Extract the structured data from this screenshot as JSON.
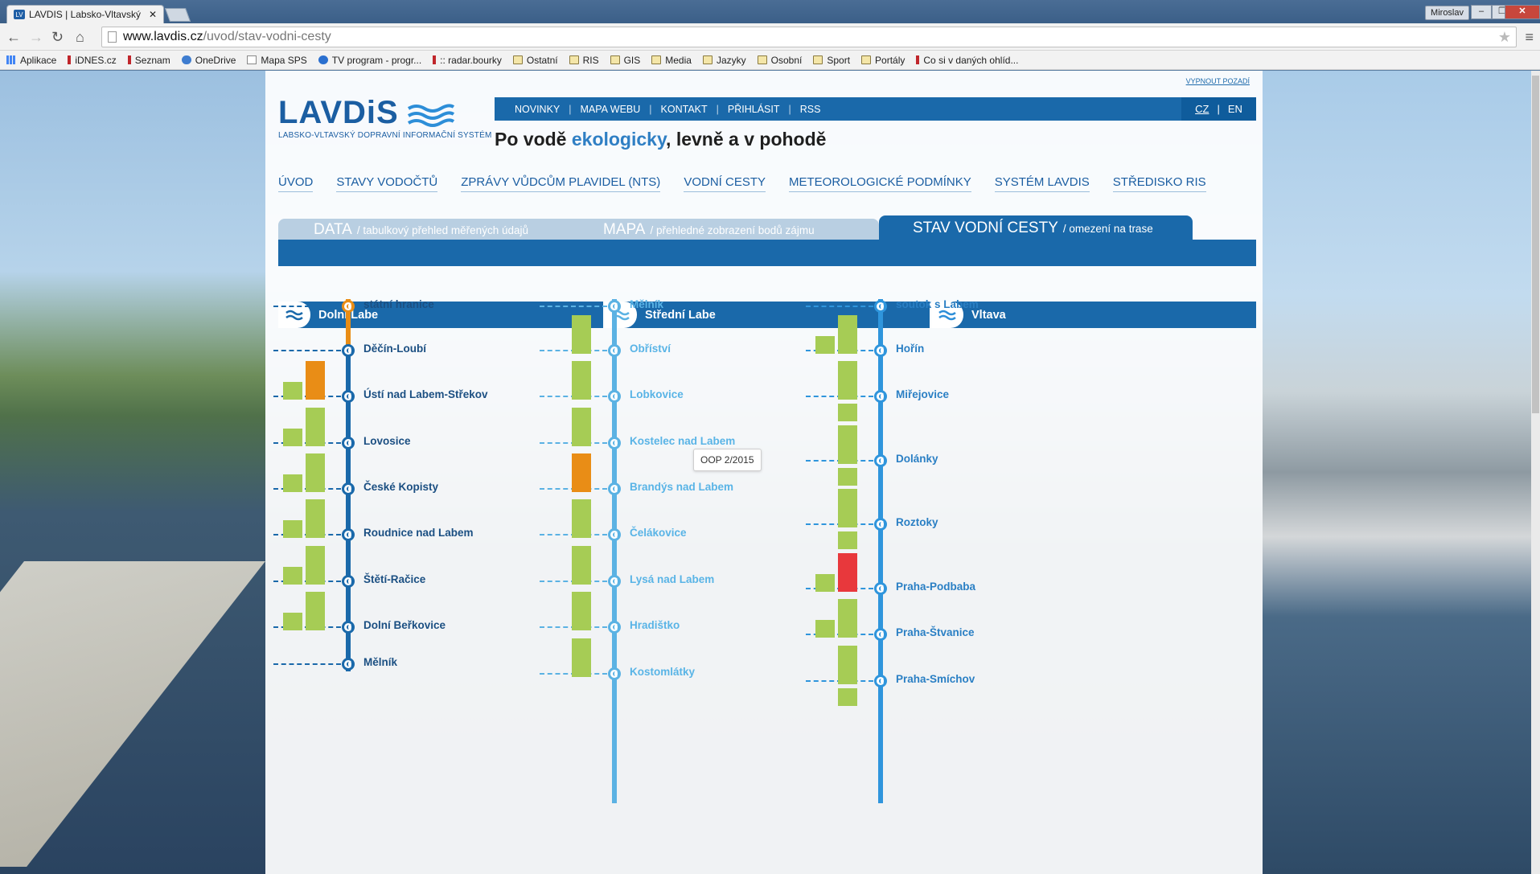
{
  "browser": {
    "tab_title": "LAVDIS | Labsko-Vltavský",
    "tab_close": "✕",
    "user": "Miroslav",
    "url_host": "www.lavdis.cz",
    "url_path": "/uvod/stav-vodni-cesty",
    "bookmarks": [
      "Aplikace",
      "iDNES.cz",
      "Seznam",
      "OneDrive",
      "Mapa SPS",
      "TV program - progr...",
      ":: radar.bourky",
      "Ostatní",
      "RIS",
      "GIS",
      "Media",
      "Jazyky",
      "Osobní",
      "Sport",
      "Portály",
      "Co si v daných ohlíd..."
    ]
  },
  "site": {
    "hide_bg": "VYPNOUT POZADÍ",
    "logo": "LAVDiS",
    "logo_sub": "LABSKO-VLTAVSKÝ DOPRAVNÍ INFORMAČNÍ SYSTÉM",
    "topnav": [
      "NOVINKY",
      "MAPA WEBU",
      "KONTAKT",
      "PŘIHLÁSIT",
      "RSS"
    ],
    "lang": [
      "CZ",
      "EN"
    ],
    "slogan_a": "Po vodě ",
    "slogan_b": "ekologicky",
    "slogan_c": ", levně a v pohodě",
    "mainnav": [
      "ÚVOD",
      "STAVY VODOČTŮ",
      "ZPRÁVY VŮDCŮM PLAVIDEL (NTS)",
      "VODNÍ CESTY",
      "METEOROLOGICKÉ PODMÍNKY",
      "SYSTÉM LAVDIS",
      "STŘEDISKO RIS"
    ],
    "subtabs": [
      {
        "big": "DATA",
        "small": "/ tabulkový přehled měřených údajů"
      },
      {
        "big": "MAPA",
        "small": "/ přehledné zobrazení bodů zájmu"
      },
      {
        "big": "STAV VODNÍ CESTY",
        "small": "/ omezení na trase"
      }
    ],
    "rivers": [
      "Dolní Labe",
      "Střední Labe",
      "Vltava"
    ],
    "tooltip": "OOP 2/2015"
  },
  "colors": {
    "green": "#a6cc55",
    "orange": "#e98d16",
    "red": "#e8383c",
    "dark_line": "#1a69aa",
    "light_line": "#5bb2e3"
  },
  "columns": [
    {
      "line": "dark",
      "stations": [
        {
          "name": "státní hranice",
          "bars": []
        },
        {
          "name": "Děčín-Loubí",
          "bars": []
        },
        {
          "name": "Ústí nad Labem-Střekov",
          "bars": [
            "green",
            "orange"
          ]
        },
        {
          "name": "Lovosice",
          "bars": [
            "green",
            "green"
          ]
        },
        {
          "name": "České Kopisty",
          "bars": [
            "green",
            "green"
          ]
        },
        {
          "name": "Roudnice nad Labem",
          "bars": [
            "green",
            "green"
          ]
        },
        {
          "name": "Štětí-Račice",
          "bars": [
            "green",
            "green"
          ]
        },
        {
          "name": "Dolní Beřkovice",
          "bars": [
            "green",
            "green"
          ]
        },
        {
          "name": "Mělník",
          "bars": []
        }
      ]
    },
    {
      "line": "light",
      "stations": [
        {
          "name": "Mělník",
          "bars": []
        },
        {
          "name": "Obříství",
          "bars": [
            "green"
          ]
        },
        {
          "name": "Lobkovice",
          "bars": [
            "green"
          ]
        },
        {
          "name": "Kostelec nad Labem",
          "bars": [
            "green"
          ]
        },
        {
          "name": "Brandýs nad Labem",
          "bars": [
            "orange"
          ]
        },
        {
          "name": "Čelákovice",
          "bars": [
            "green"
          ]
        },
        {
          "name": "Lysá nad Labem",
          "bars": [
            "green"
          ]
        },
        {
          "name": "Hradištko",
          "bars": [
            "green"
          ]
        },
        {
          "name": "Kostomlátky",
          "bars": [
            "green"
          ]
        }
      ]
    },
    {
      "line": "mid",
      "stations": [
        {
          "name": "soutok s Labem",
          "bars": []
        },
        {
          "name": "Hořín",
          "bars": [
            "green",
            "green"
          ]
        },
        {
          "name": "Miřejovice",
          "bars": [
            "green"
          ]
        },
        {
          "name": "Dolánky",
          "bars": [
            "green"
          ]
        },
        {
          "name": "Roztoky",
          "bars": [
            "green"
          ]
        },
        {
          "name": "Praha-Podbaba",
          "bars": [
            "green",
            "red"
          ]
        },
        {
          "name": "Praha-Štvanice",
          "bars": [
            "green",
            "green"
          ]
        },
        {
          "name": "Praha-Smíchov",
          "bars": [
            "green"
          ]
        }
      ]
    }
  ]
}
